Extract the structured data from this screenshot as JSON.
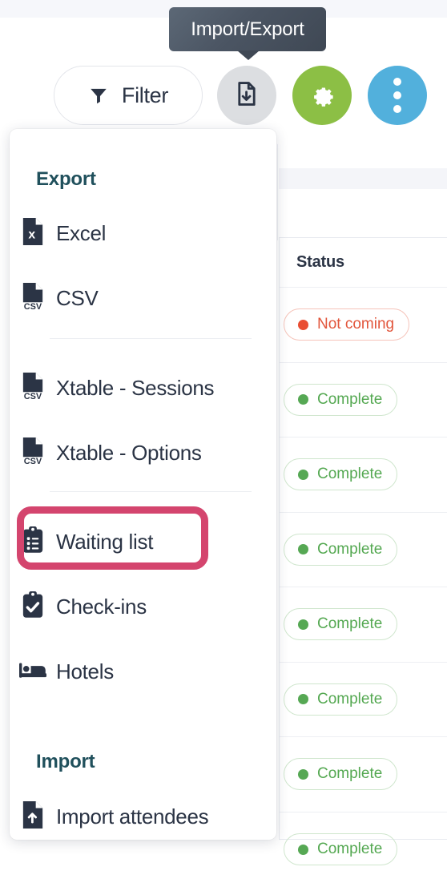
{
  "tooltip": {
    "text": "Import/Export"
  },
  "toolbar": {
    "filter_label": "Filter",
    "import_export_name": "import-export",
    "settings_name": "settings",
    "more_name": "more-options",
    "colors": {
      "import_export_bg": "#dcdee1",
      "settings_bg": "#8cbf45",
      "more_bg": "#52b0dc",
      "icon_dark": "#2b3445"
    }
  },
  "menu": {
    "export_title": "Export",
    "import_title": "Import",
    "export_items": [
      {
        "label": "Excel",
        "icon": "file-excel-icon"
      },
      {
        "label": "CSV",
        "icon": "file-csv-icon"
      },
      {
        "label": "Xtable - Sessions",
        "icon": "file-csv-icon"
      },
      {
        "label": "Xtable - Options",
        "icon": "file-csv-icon"
      },
      {
        "label": "Waiting list",
        "icon": "clipboard-list-icon"
      },
      {
        "label": "Check-ins",
        "icon": "clipboard-check-icon"
      },
      {
        "label": "Hotels",
        "icon": "bed-icon"
      }
    ],
    "import_items": [
      {
        "label": "Import attendees",
        "icon": "file-upload-icon"
      }
    ],
    "highlight": {
      "target": "Waiting list",
      "color": "#d4456e"
    }
  },
  "table": {
    "header": "Status",
    "rows": [
      {
        "status": "Not coming",
        "tone": "red"
      },
      {
        "status": "Complete",
        "tone": "green"
      },
      {
        "status": "Complete",
        "tone": "green"
      },
      {
        "status": "Complete",
        "tone": "green"
      },
      {
        "status": "Complete",
        "tone": "green"
      },
      {
        "status": "Complete",
        "tone": "green"
      },
      {
        "status": "Complete",
        "tone": "green"
      },
      {
        "status": "Complete",
        "tone": "green"
      }
    ],
    "colors": {
      "green": "#56a854",
      "red": "#e94e33"
    }
  }
}
